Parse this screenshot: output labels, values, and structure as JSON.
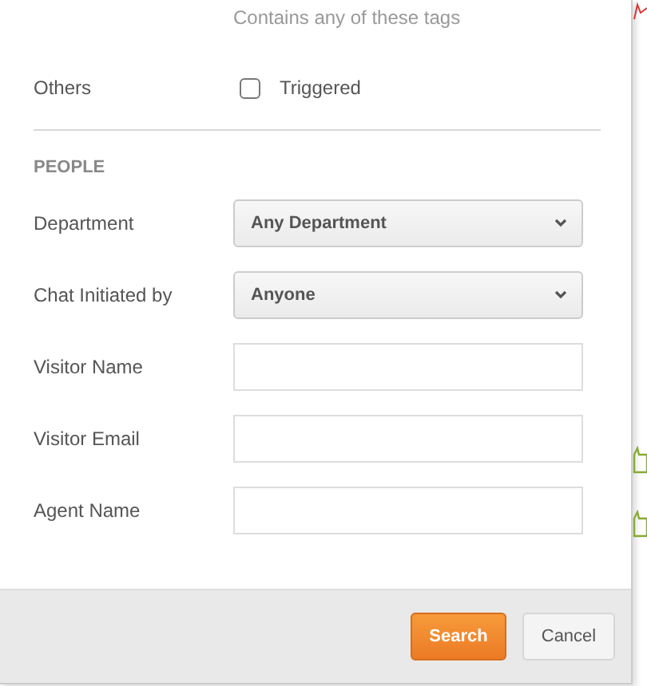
{
  "tags_hint": "Contains any of these tags",
  "others": {
    "label": "Others",
    "checkbox": {
      "label": "Triggered",
      "checked": false
    }
  },
  "section": "PEOPLE",
  "fields": [
    {
      "kind": "select",
      "label": "Department",
      "value": "Any Department"
    },
    {
      "kind": "select",
      "label": "Chat Initiated by",
      "value": "Anyone"
    },
    {
      "kind": "text",
      "label": "Visitor Name"
    },
    {
      "kind": "text",
      "label": "Visitor Email"
    },
    {
      "kind": "text",
      "label": "Agent Name"
    }
  ],
  "buttons": [
    {
      "label": "Search",
      "kind": "primary"
    },
    {
      "label": "Cancel",
      "kind": "secondary"
    }
  ]
}
